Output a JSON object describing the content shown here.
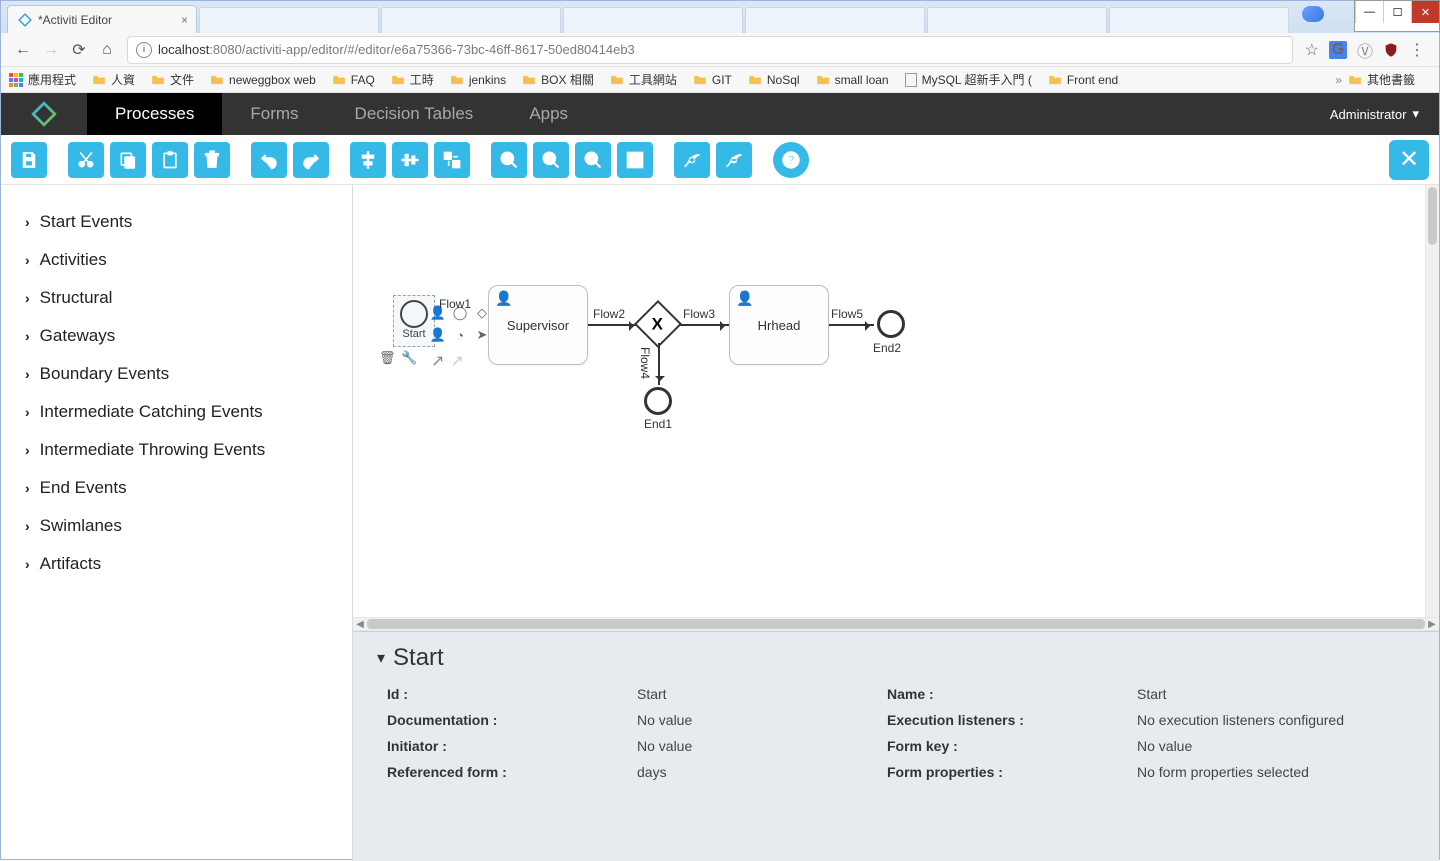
{
  "browser": {
    "active_tab_title": "*Activiti Editor",
    "url_host": "localhost",
    "url_rest": ":8080/activiti-app/editor/#/editor/e6a75366-73bc-46ff-8617-50ed80414eb3"
  },
  "bookmarks": [
    {
      "label": "應用程式",
      "icon": "apps"
    },
    {
      "label": "人資",
      "icon": "folder"
    },
    {
      "label": "文件",
      "icon": "folder"
    },
    {
      "label": "neweggbox web",
      "icon": "folder"
    },
    {
      "label": "FAQ",
      "icon": "folder"
    },
    {
      "label": "工時",
      "icon": "folder"
    },
    {
      "label": "jenkins",
      "icon": "folder"
    },
    {
      "label": "BOX 相關",
      "icon": "folder"
    },
    {
      "label": "工具網站",
      "icon": "folder"
    },
    {
      "label": "GIT",
      "icon": "folder"
    },
    {
      "label": "NoSql",
      "icon": "folder"
    },
    {
      "label": "small loan",
      "icon": "folder"
    },
    {
      "label": "MySQL 超新手入門 (",
      "icon": "file"
    },
    {
      "label": "Front end",
      "icon": "folder"
    }
  ],
  "bookmark_overflow": "其他書籤",
  "header": {
    "tabs": [
      "Processes",
      "Forms",
      "Decision Tables",
      "Apps"
    ],
    "active_tab": 0,
    "user": "Administrator"
  },
  "toolbar": {
    "groups": [
      [
        "save"
      ],
      [
        "cut",
        "copy",
        "paste",
        "delete"
      ],
      [
        "undo",
        "redo"
      ],
      [
        "align-v",
        "align-h",
        "same-size"
      ],
      [
        "zoom-in",
        "zoom-out",
        "zoom-actual",
        "zoom-fit"
      ],
      [
        "bendpoint-add",
        "bendpoint-remove"
      ],
      [
        "help"
      ]
    ],
    "close": "✕"
  },
  "palette": [
    "Start Events",
    "Activities",
    "Structural",
    "Gateways",
    "Boundary Events",
    "Intermediate Catching Events",
    "Intermediate Throwing Events",
    "End Events",
    "Swimlanes",
    "Artifacts"
  ],
  "diagram": {
    "start_label": "Start",
    "flows": [
      "Flow1",
      "Flow2",
      "Flow3",
      "Flow4",
      "Flow5"
    ],
    "task1": "Supervisor",
    "task2": "Hrhead",
    "end1": "End1",
    "end2": "End2"
  },
  "properties": {
    "title": "Start",
    "rows": [
      {
        "label": "Id :",
        "value": "Start",
        "label2": "Name :",
        "value2": "Start"
      },
      {
        "label": "Documentation :",
        "value": "No value",
        "label2": "Execution listeners :",
        "value2": "No execution listeners configured"
      },
      {
        "label": "Initiator :",
        "value": "No value",
        "label2": "Form key :",
        "value2": "No value"
      },
      {
        "label": "Referenced form :",
        "value": "days",
        "label2": "Form properties :",
        "value2": "No form properties selected"
      }
    ]
  }
}
